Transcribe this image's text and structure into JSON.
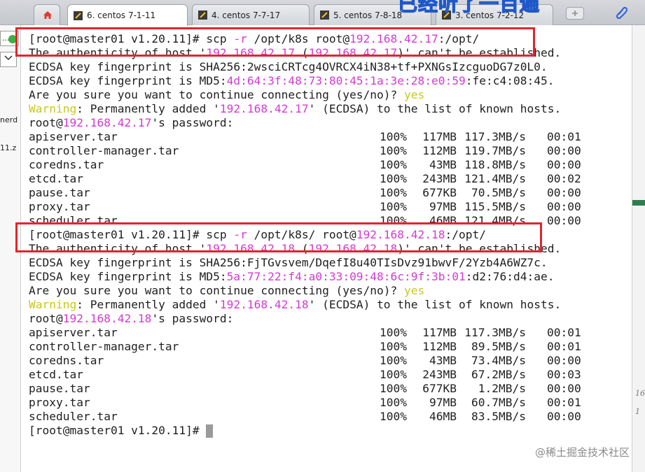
{
  "overlay_caption": "已经听了一百遍",
  "tabs": [
    {
      "label": "",
      "icon": "home-icon",
      "active": false
    },
    {
      "label": "6. centos 7-1-11",
      "icon": "terminal-icon",
      "active": true
    },
    {
      "label": "4. centos 7-7-17",
      "icon": "terminal-icon",
      "active": false
    },
    {
      "label": "5. centos 7-8-18",
      "icon": "terminal-icon",
      "active": false
    },
    {
      "label": "3. centos 7-2-12",
      "icon": "terminal-icon",
      "active": false
    }
  ],
  "left_strip": {
    "box1": "...",
    "texts": [
      "nerd",
      "11.z"
    ]
  },
  "right_strip": {
    "texts": [
      "16",
      "1"
    ]
  },
  "terminal": {
    "cmd1": {
      "prompt": "[root@master01 v1.20.11]# ",
      "cmd": "scp ",
      "flag": "-r",
      "path": " /opt/k8s root@",
      "host": "192.168.42.17",
      "dest": ":/opt/"
    },
    "auth1": {
      "pre": "The authenticity of host '",
      "h1": "192.168.42.17",
      "mid": " (",
      "h2": "192.168.42.17",
      "post": ")' can't be established."
    },
    "sha1": "ECDSA key fingerprint is SHA256:2wsciCRTcg4OVRCX4iN38+tf+PXNGsIzcguoDG7z0L0.",
    "md51": {
      "pre": "ECDSA key fingerprint is MD5:",
      "hl": "4d:64:3f:48:73:80:45:1a:3e:28:e0:59",
      "post": ":fe:c4:08:45."
    },
    "confirm1": {
      "q": "Are you sure you want to continue connecting (yes/no)? ",
      "ans": "yes"
    },
    "warn1": {
      "w": "Warning",
      "pre": ": Permanently added '",
      "host": "192.168.42.17",
      "post": "' (ECDSA) to the list of known hosts."
    },
    "pw1": {
      "pre": "root@",
      "host": "192.168.42.17",
      "post": "'s password:"
    },
    "transfers1": [
      {
        "name": "apiserver.tar",
        "pct": "100%",
        "size": "117MB",
        "speed": "117.3MB/s",
        "time": "00:01"
      },
      {
        "name": "controller-manager.tar",
        "pct": "100%",
        "size": "112MB",
        "speed": "119.7MB/s",
        "time": "00:00"
      },
      {
        "name": "coredns.tar",
        "pct": "100%",
        "size": "43MB",
        "speed": "118.8MB/s",
        "time": "00:00"
      },
      {
        "name": "etcd.tar",
        "pct": "100%",
        "size": "243MB",
        "speed": "121.4MB/s",
        "time": "00:02"
      },
      {
        "name": "pause.tar",
        "pct": "100%",
        "size": "677KB",
        "speed": "70.5MB/s",
        "time": "00:00"
      },
      {
        "name": "proxy.tar",
        "pct": "100%",
        "size": "97MB",
        "speed": "115.5MB/s",
        "time": "00:00"
      },
      {
        "name": "scheduler.tar",
        "pct": "100%",
        "size": "46MB",
        "speed": "121.4MB/s",
        "time": "00:00"
      }
    ],
    "cmd2": {
      "prompt": "[root@master01 v1.20.11]# ",
      "cmd": "scp ",
      "flag": "-r",
      "path": " /opt/k8s/ root@",
      "host": "192.168.42.18",
      "dest": ":/opt/"
    },
    "auth2": {
      "pre": "The authenticity of host '",
      "h1": "192.168.42.18",
      "mid": " (",
      "h2": "192.168.42.18",
      "post": ")' can't be established."
    },
    "sha2": "ECDSA key fingerprint is SHA256:FjTGvsvem/DqefI8u40TIsDvz91bwvF/2Yzb4A6WZ7c.",
    "md52": {
      "pre": "ECDSA key fingerprint is MD5:",
      "hl": "5a:77:22:f4:a0:33:09:48:6c:9f:3b:01",
      "post": ":d2:76:d4:ae."
    },
    "confirm2": {
      "q": "Are you sure you want to continue connecting (yes/no)? ",
      "ans": "yes"
    },
    "warn2": {
      "w": "Warning",
      "pre": ": Permanently added '",
      "host": "192.168.42.18",
      "post": "' (ECDSA) to the list of known hosts."
    },
    "pw2": {
      "pre": "root@",
      "host": "192.168.42.18",
      "post": "'s password:"
    },
    "transfers2": [
      {
        "name": "apiserver.tar",
        "pct": "100%",
        "size": "117MB",
        "speed": "117.3MB/s",
        "time": "00:01"
      },
      {
        "name": "controller-manager.tar",
        "pct": "100%",
        "size": "112MB",
        "speed": "89.5MB/s",
        "time": "00:01"
      },
      {
        "name": "coredns.tar",
        "pct": "100%",
        "size": "43MB",
        "speed": "73.4MB/s",
        "time": "00:00"
      },
      {
        "name": "etcd.tar",
        "pct": "100%",
        "size": "243MB",
        "speed": "67.2MB/s",
        "time": "00:03"
      },
      {
        "name": "pause.tar",
        "pct": "100%",
        "size": "677KB",
        "speed": "1.2MB/s",
        "time": "00:00"
      },
      {
        "name": "proxy.tar",
        "pct": "100%",
        "size": "97MB",
        "speed": "60.7MB/s",
        "time": "00:01"
      },
      {
        "name": "scheduler.tar",
        "pct": "100%",
        "size": "46MB",
        "speed": "83.5MB/s",
        "time": "00:00"
      }
    ],
    "final_prompt": "[root@master01 v1.20.11]# "
  },
  "watermark": "@稀土掘金技术社区",
  "colors": {
    "highlight_magenta": "#d33ad3",
    "highlight_yellow": "#c8c81e",
    "annotation_red": "#e0262b"
  }
}
